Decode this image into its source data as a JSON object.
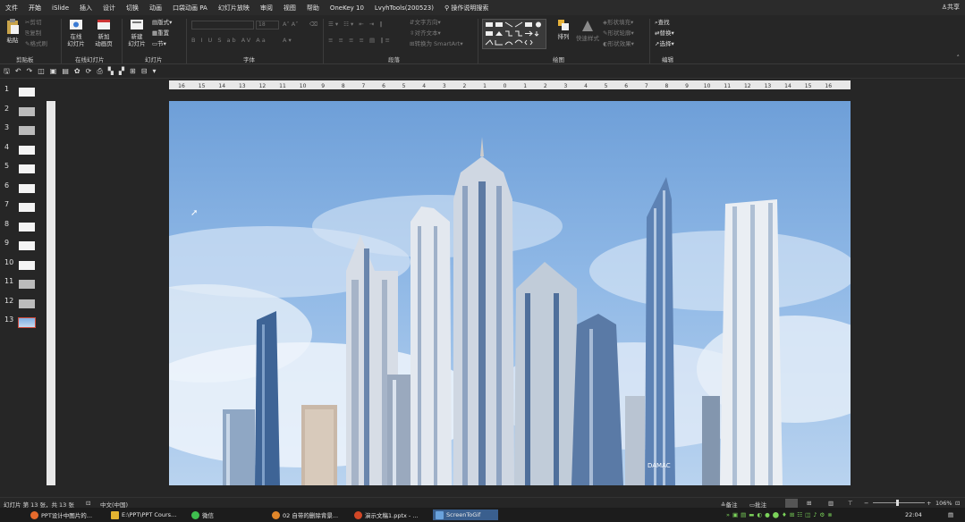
{
  "menubar": {
    "items": [
      "文件",
      "开始",
      "iSlide",
      "插入",
      "设计",
      "切换",
      "动画",
      "口袋动画 PA",
      "幻灯片放映",
      "审阅",
      "视图",
      "帮助",
      "OneKey 10",
      "LvyhTools(200523)"
    ],
    "search_label": "操作说明搜索",
    "share_label": "共享"
  },
  "ribbon": {
    "clipboard": {
      "paste": "粘贴",
      "cut": "剪切",
      "copy": "复制",
      "format_painter": "格式刷",
      "group": "剪贴板"
    },
    "online_slides": {
      "online": "在线\n幻灯片",
      "new_anim": "新加\n动画页",
      "group": "在线幻灯片"
    },
    "slides": {
      "new_slide": "新建\n幻灯片",
      "layout": "版式",
      "reset": "重置",
      "section": "节",
      "group": "幻灯片"
    },
    "font": {
      "font_size": "18",
      "group": "字体"
    },
    "paragraph": {
      "text_direction": "文字方向",
      "align_text": "对齐文本",
      "smartart": "转换为 SmartArt",
      "group": "段落"
    },
    "drawing": {
      "arrange": "排列",
      "quick_styles": "快速样式",
      "fill": "形状填充",
      "outline": "形状轮廓",
      "effects": "形状效果",
      "group": "绘图"
    },
    "editing": {
      "find": "查找",
      "replace": "替换",
      "select": "选择",
      "group": "编辑"
    }
  },
  "ruler": {
    "ticks": [
      "16",
      "15",
      "14",
      "13",
      "12",
      "11",
      "10",
      "9",
      "8",
      "7",
      "6",
      "5",
      "4",
      "3",
      "2",
      "1",
      "0",
      "1",
      "2",
      "3",
      "4",
      "5",
      "6",
      "7",
      "8",
      "9",
      "10",
      "11",
      "12",
      "13",
      "14",
      "15",
      "16"
    ]
  },
  "thumbnails": [
    "1",
    "2",
    "3",
    "4",
    "5",
    "6",
    "7",
    "8",
    "9",
    "10",
    "11",
    "12",
    "13"
  ],
  "selected_slide": "13",
  "slide": {
    "watermark": "DAMAC"
  },
  "status": {
    "slide_info": "幻灯片 第 13 张，共 13 张",
    "language": "中文(中国)",
    "notes": "备注",
    "comments": "批注",
    "zoom": "106%"
  },
  "taskbar": {
    "items": [
      "PPT设计中图片的...",
      "E:\\PPT\\PPT Cours...",
      "微信",
      "02 自带的删除背景...",
      "演示文稿1.pptx - ...",
      "ScreenToGif"
    ],
    "clock": "22:04",
    "active_index": 5
  },
  "colors": {
    "accent": "#3a5f8e",
    "bg": "#262626",
    "sky": "#7fb0e3"
  }
}
